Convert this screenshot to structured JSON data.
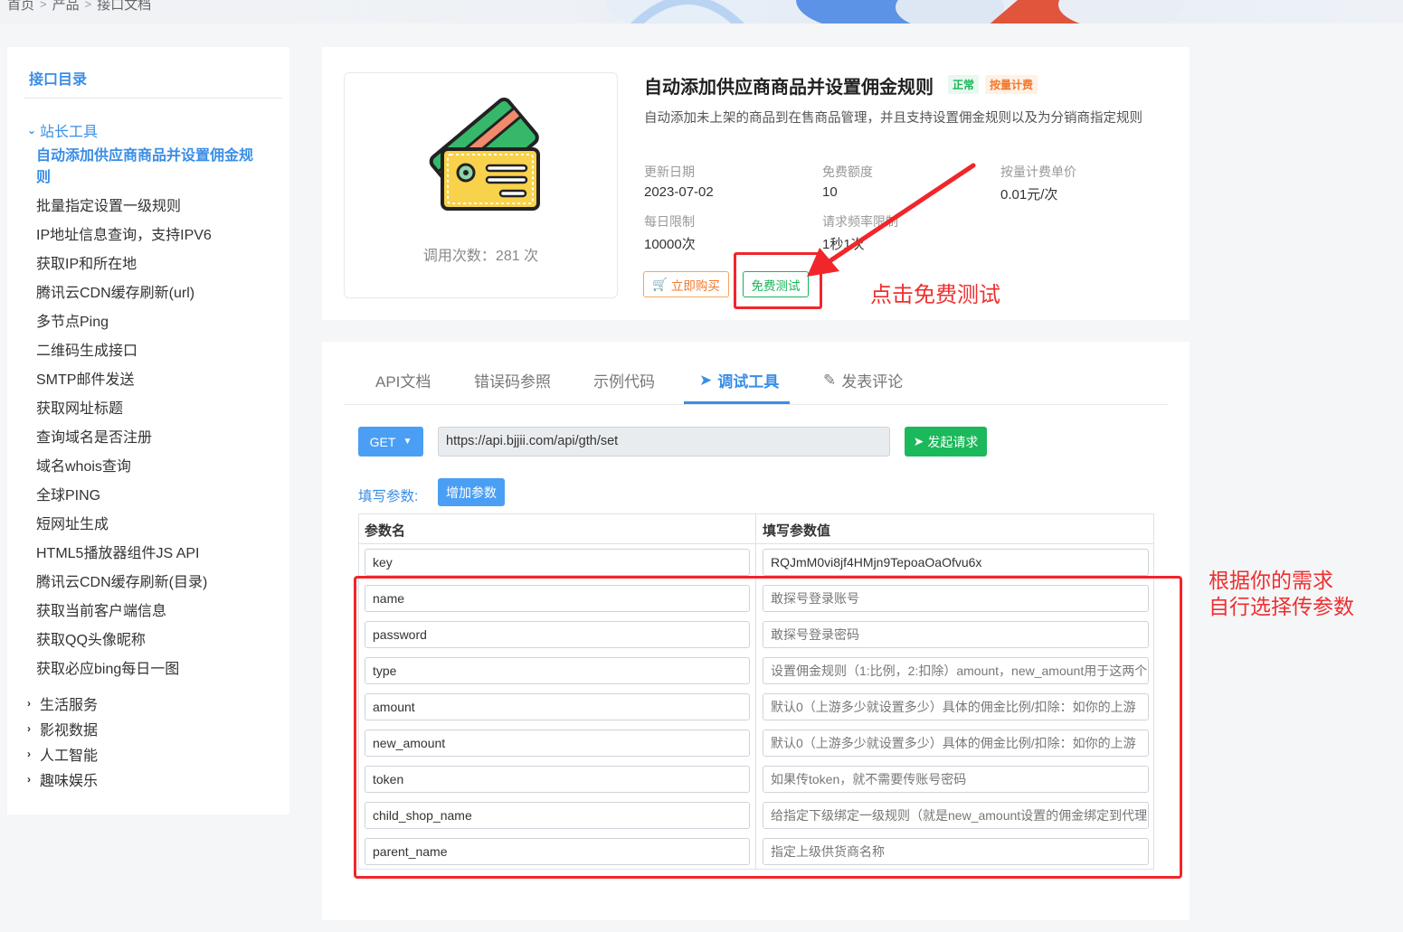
{
  "breadcrumb": {
    "home": "首页",
    "products": "产品",
    "current": "接口文档"
  },
  "sidebar": {
    "title": "接口目录",
    "open_group": "站长工具",
    "items": [
      "自动添加供应商商品并设置佣金规则",
      "批量指定设置一级规则",
      "IP地址信息查询，支持IPV6",
      "获取IP和所在地",
      "腾讯云CDN缓存刷新(url)",
      "多节点Ping",
      "二维码生成接口",
      "SMTP邮件发送",
      "获取网址标题",
      "查询域名是否注册",
      "域名whois查询",
      "全球PING",
      "短网址生成",
      "HTML5播放器组件JS API",
      "腾讯云CDN缓存刷新(目录)",
      "获取当前客户端信息",
      "获取QQ头像昵称",
      "获取必应bing每日一图"
    ],
    "collapsed_groups": [
      "生活服务",
      "影视数据",
      "人工智能",
      "趣味娱乐"
    ]
  },
  "product": {
    "title": "自动添加供应商商品并设置佣金规则",
    "status_badge": "正常",
    "billing_badge": "按量计费",
    "description": "自动添加未上架的商品到在售商品管理，并且支持设置佣金规则以及为分销商指定规则",
    "call_count": "调用次数：281 次",
    "update_label": "更新日期",
    "update_value": "2023-07-02",
    "free_quota_label": "免费额度",
    "free_quota_value": "10",
    "unit_price_label": "按量计费单价",
    "unit_price_value": "0.01元/次",
    "daily_limit_label": "每日限制",
    "daily_limit_value": "10000次",
    "rate_label": "请求频率限制",
    "rate_value": "1秒1次",
    "buy_label": "立即购买",
    "free_test_label": "免费测试"
  },
  "annotations": {
    "click_free_test": "点击免费测试",
    "params_line1": "根据你的需求",
    "params_line2": "自行选择传参数"
  },
  "tabs": [
    {
      "label": "API文档"
    },
    {
      "label": "错误码参照"
    },
    {
      "label": "示例代码"
    },
    {
      "label": "调试工具"
    },
    {
      "label": "发表评论"
    }
  ],
  "debug": {
    "method": "GET",
    "url": "https://api.bjjii.com/api/gth/set",
    "send_label": "发起请求",
    "fill_label": "填写参数:",
    "add_param_label": "增加参数",
    "col_name": "参数名",
    "col_value": "填写参数值",
    "params": [
      {
        "name": "key",
        "value": "RQJmM0vi8jf4HMjn9TepoaOaOfvu6x",
        "placeholder": ""
      },
      {
        "name": "name",
        "value": "",
        "placeholder": "敢探号登录账号"
      },
      {
        "name": "password",
        "value": "",
        "placeholder": "敢探号登录密码"
      },
      {
        "name": "type",
        "value": "",
        "placeholder": "设置佣金规则（1:比例，2:扣除）amount，new_amount用于这两个"
      },
      {
        "name": "amount",
        "value": "",
        "placeholder": "默认0（上游多少就设置多少）具体的佣金比例/扣除：如你的上游"
      },
      {
        "name": "new_amount",
        "value": "",
        "placeholder": "默认0（上游多少就设置多少）具体的佣金比例/扣除：如你的上游"
      },
      {
        "name": "token",
        "value": "",
        "placeholder": "如果传token，就不需要传账号密码"
      },
      {
        "name": "child_shop_name",
        "value": "",
        "placeholder": "给指定下级绑定一级规则（就是new_amount设置的佣金绑定到代理"
      },
      {
        "name": "parent_name",
        "value": "",
        "placeholder": "指定上级供货商名称"
      }
    ]
  },
  "colors": {
    "accent": "#3a8ee6",
    "success": "#1cb85c",
    "warning": "#f0782d",
    "annotation_red": "#f0262b"
  }
}
